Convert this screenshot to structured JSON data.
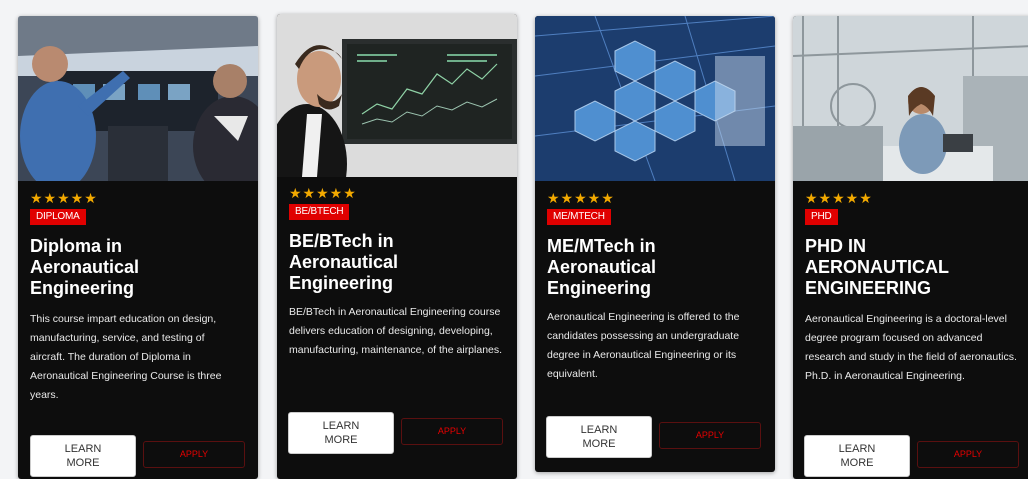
{
  "cards": [
    {
      "badge": "DIPLOMA",
      "stars": "★★★★★",
      "title": "Diploma in Aeronautical Engineering",
      "description": "This course impart education on design, manufacturing, service, and testing of aircraft. The duration of Diploma in Aeronautical Engineering Course is three years.",
      "learn_more": "LEARN MORE",
      "apply": "APPLY",
      "image": "cockpit-photo"
    },
    {
      "badge": "BE/BTECH",
      "stars": "★★★★★",
      "title": "BE/BTech in Aeronautical Engineering",
      "description": "BE/BTech in Aeronautical Engineering course delivers education of designing, developing, manufacturing, maintenance, of the airplanes.",
      "learn_more": "LEARN MORE",
      "apply": "APPLY",
      "image": "trading-screen-photo"
    },
    {
      "badge": "ME/MTECH",
      "stars": "★★★★★",
      "title": "ME/MTech in Aeronautical Engineering",
      "description": "Aeronautical Engineering is offered to the candidates possessing an undergraduate degree in Aeronautical Engineering or its equivalent.",
      "learn_more": "LEARN MORE",
      "apply": "APPLY",
      "image": "telescope-mirror-photo"
    },
    {
      "badge": "PHD",
      "stars": "★★★★★",
      "title": "PHD IN AERONAUTICAL ENGINEERING",
      "description": "Aeronautical Engineering is a doctoral-level degree program focused on advanced research and study in the field of aeronautics. Ph.D. in Aeronautical Engineering.",
      "learn_more": "LEARN MORE",
      "apply": "APPLY",
      "image": "lab-engineer-photo"
    }
  ],
  "colors": {
    "card_bg": "#0d0d0d",
    "badge_red": "#e00000",
    "star_gold": "#f2a900",
    "apply_red": "#e60000"
  }
}
